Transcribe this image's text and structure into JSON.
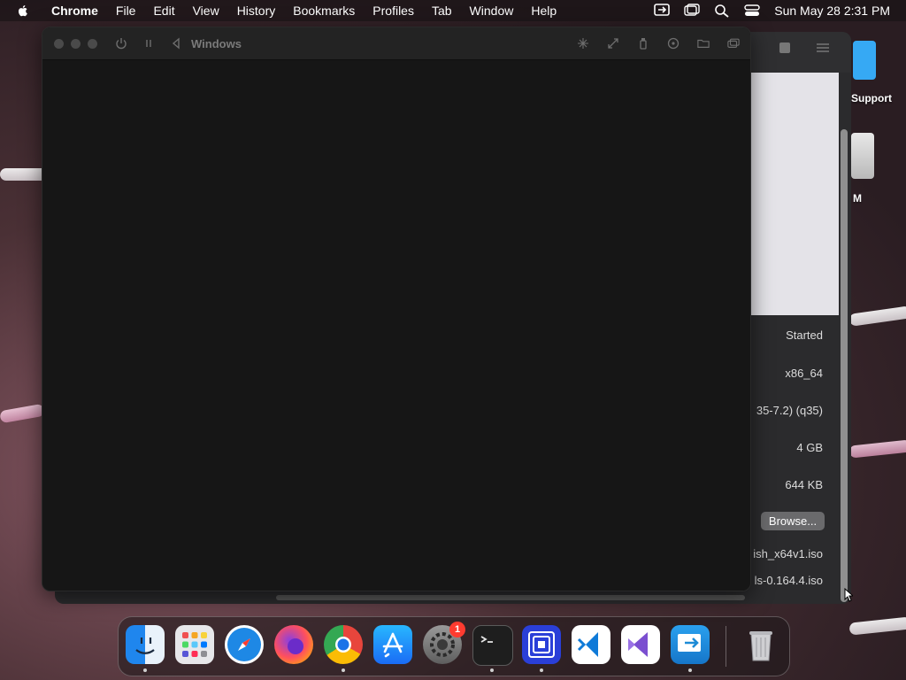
{
  "menubar": {
    "app_name": "Chrome",
    "menus": [
      "File",
      "Edit",
      "View",
      "History",
      "Bookmarks",
      "Profiles",
      "Tab",
      "Window",
      "Help"
    ],
    "clock": "Sun May 28  2:31 PM",
    "status_icons": [
      "screen-mirroring-icon",
      "window-icon",
      "search-icon",
      "control-center-icon"
    ]
  },
  "desktop": {
    "folder_label": "Support",
    "drive_label": "M"
  },
  "background_window": {
    "rows": [
      {
        "value": "Started"
      },
      {
        "value": "x86_64"
      },
      {
        "value": "35-7.2) (q35)"
      },
      {
        "value": "4 GB"
      },
      {
        "value": "644 KB"
      },
      {
        "value": "ish_x64v1.iso"
      },
      {
        "value": "ls-0.164.4.iso"
      }
    ],
    "browse_label": "Browse..."
  },
  "vm_window": {
    "title": "Windows",
    "toolbar_left_icons": [
      "power-icon",
      "pause-icon",
      "back-icon"
    ],
    "toolbar_right_icons": [
      "sparkle-icon",
      "resize-icon",
      "usb-icon",
      "drive-icon",
      "folder-icon",
      "windows-icon"
    ]
  },
  "dock": {
    "apps": [
      {
        "name": "Finder",
        "icon": "finder-icon",
        "color": "#2a8df0",
        "running": true
      },
      {
        "name": "Launchpad",
        "icon": "launchpad-icon",
        "color": "#d8d8d8",
        "running": false
      },
      {
        "name": "Safari",
        "icon": "safari-icon",
        "color": "#1e88e5",
        "running": false
      },
      {
        "name": "Firefox",
        "icon": "firefox-icon",
        "color": "#ff7a1a",
        "running": false
      },
      {
        "name": "Chrome",
        "icon": "chrome-icon",
        "color": "#e8453c",
        "running": true
      },
      {
        "name": "App Store",
        "icon": "app-store-icon",
        "color": "#1c8ef9",
        "running": false
      },
      {
        "name": "System Settings",
        "icon": "system-settings-icon",
        "color": "#8c8c8c",
        "running": false,
        "badge": "1"
      },
      {
        "name": "Terminal",
        "icon": "terminal-icon",
        "color": "#1c1c1c",
        "running": true
      },
      {
        "name": "UTM",
        "icon": "utm-icon",
        "color": "#2a3fd8",
        "running": true
      },
      {
        "name": "VS Code",
        "icon": "vscode-icon",
        "color": "#0f7ad8",
        "running": false
      },
      {
        "name": "Visual Studio",
        "icon": "visual-studio-icon",
        "color": "#7b4fd0",
        "running": false
      },
      {
        "name": "Remote Desktop",
        "icon": "remote-desktop-icon",
        "color": "#1d8bd6",
        "running": true
      },
      {
        "name": "Trash",
        "icon": "trash-icon",
        "color": "#b9b9b9",
        "running": false
      }
    ]
  }
}
